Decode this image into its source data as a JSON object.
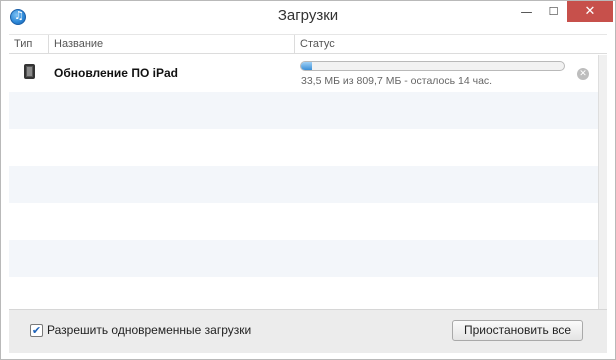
{
  "window": {
    "title": "Загрузки",
    "controls": {
      "minimize": "—",
      "maximize": "☐",
      "close": "✕"
    }
  },
  "columns": {
    "type": "Тип",
    "name": "Название",
    "status": "Статус"
  },
  "downloads": [
    {
      "icon": "ipad-icon",
      "name": "Обновление ПО iPad",
      "progress_fraction": 0.04,
      "status_text": "33,5 МБ из 809,7 МБ - осталось 14 час.",
      "cancel_glyph": "✕"
    }
  ],
  "footer": {
    "checkbox_checked": true,
    "checkbox_glyph": "✔",
    "checkbox_label": "Разрешить одновременные загрузки",
    "pause_all_label": "Приостановить все"
  },
  "colors": {
    "close_button": "#c7504b",
    "progress_fill": "#3c8fd6",
    "stripe": "#f3f6fa"
  }
}
